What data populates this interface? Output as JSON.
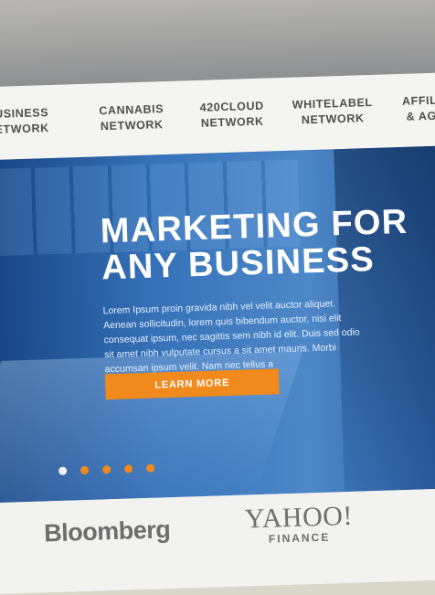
{
  "nav": {
    "items": [
      {
        "line1": "BUSINESS",
        "line2": "NETWORK"
      },
      {
        "line1": "CANNABIS",
        "line2": "NETWORK"
      },
      {
        "line1": "420CLOUD",
        "line2": "NETWORK"
      },
      {
        "line1": "WHITELABEL",
        "line2": "NETWORK"
      },
      {
        "line1": "AFFILIATES",
        "line2": "& AGENTS"
      }
    ]
  },
  "hero": {
    "headline_line1": "MARKETING FOR",
    "headline_line2": "ANY BUSINESS",
    "body": "Lorem Ipsum proin gravida nibh vel velit auctor aliquet. Aenean sollicitudin, lorem quis bibendum auctor, nisi elit consequat ipsum, nec sagittis sem nibh id elit. Duis sed odio sit amet nibh vulputate cursus a sit amet mauris. Morbi accumsan ipsum velit. Nam nec tellus a",
    "cta_label": "LEARN MORE",
    "slides_count": 5,
    "active_slide": 1
  },
  "press": {
    "bloomberg": "Bloomberg",
    "yahoo_main": "YAHOO!",
    "yahoo_sub": "FINANCE"
  },
  "colors": {
    "accent": "#f08a1c",
    "hero_blue": "#1e6ec8",
    "nav_text": "#4e4e4e"
  }
}
